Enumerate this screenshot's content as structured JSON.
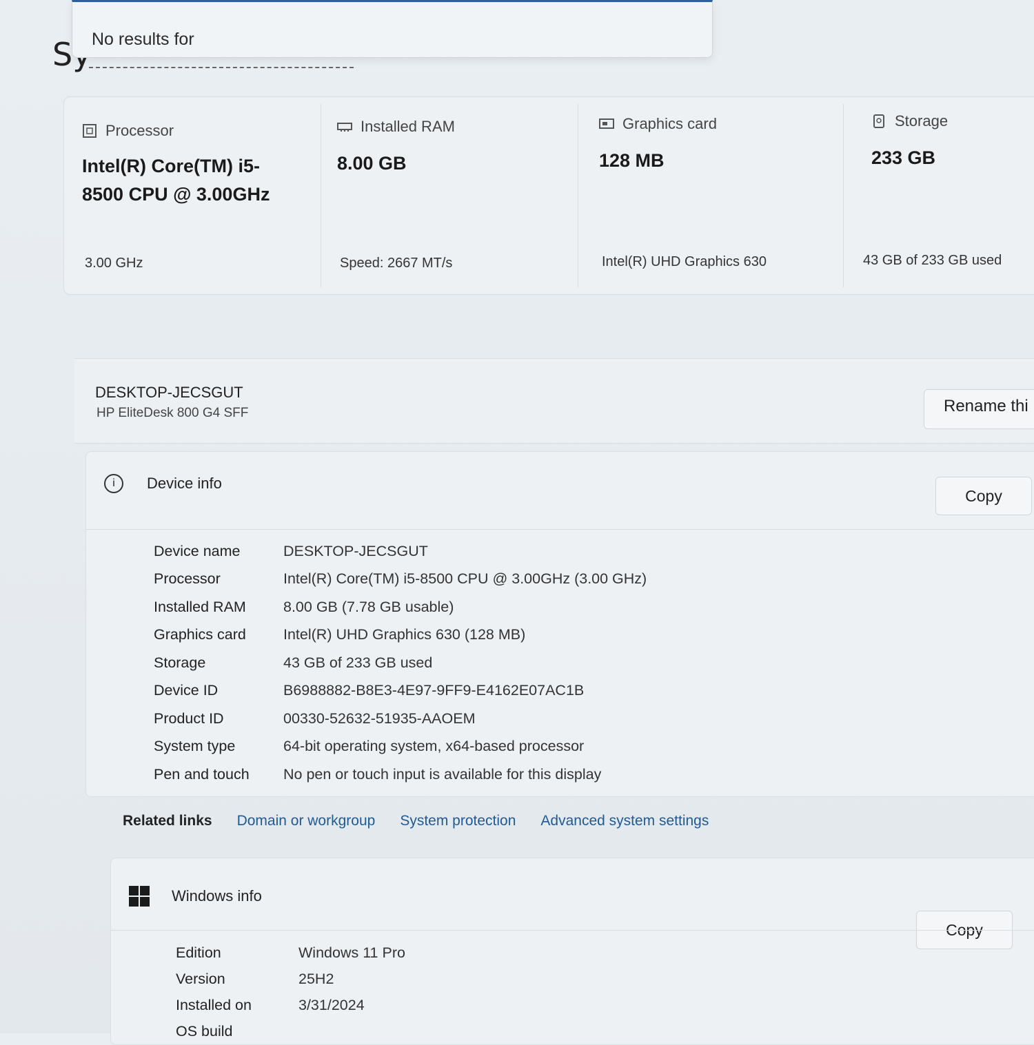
{
  "page": {
    "title_fragment": "Sy"
  },
  "search": {
    "no_results_text": "No results for"
  },
  "specs": [
    {
      "icon": "processor-icon",
      "label": "Processor",
      "value": "Intel(R) Core(TM) i5-8500 CPU @ 3.00GHz",
      "sub": "3.00 GHz"
    },
    {
      "icon": "ram-icon",
      "label": "Installed RAM",
      "value": "8.00 GB",
      "sub": "Speed: 2667 MT/s"
    },
    {
      "icon": "graphics-card-icon",
      "label": "Graphics card",
      "value": "128 MB",
      "sub": "Intel(R) UHD Graphics 630"
    },
    {
      "icon": "storage-icon",
      "label": "Storage",
      "value": "233 GB",
      "sub": "43 GB of 233 GB used"
    }
  ],
  "device": {
    "name": "DESKTOP-JECSGUT",
    "model": "HP EliteDesk 800 G4 SFF",
    "rename_label": "Rename thi"
  },
  "device_info": {
    "title": "Device info",
    "copy_label": "Copy",
    "rows": [
      {
        "k": "Device name",
        "v": "DESKTOP-JECSGUT"
      },
      {
        "k": "Processor",
        "v": "Intel(R) Core(TM) i5-8500 CPU @ 3.00GHz (3.00 GHz)"
      },
      {
        "k": "Installed RAM",
        "v": "8.00 GB (7.78 GB usable)"
      },
      {
        "k": "Graphics card",
        "v": "Intel(R) UHD Graphics 630 (128 MB)"
      },
      {
        "k": "Storage",
        "v": "43 GB of 233 GB used"
      },
      {
        "k": "Device ID",
        "v": "B6988882-B8E3-4E97-9FF9-E4162E07AC1B"
      },
      {
        "k": "Product ID",
        "v": "00330-52632-51935-AAOEM"
      },
      {
        "k": "System type",
        "v": "64-bit operating system, x64-based processor"
      },
      {
        "k": "Pen and touch",
        "v": "No pen or touch input is available for this display"
      }
    ]
  },
  "related_links": {
    "label": "Related links",
    "links": [
      "Domain or workgroup",
      "System protection",
      "Advanced system settings"
    ]
  },
  "windows_info": {
    "title": "Windows info",
    "copy_label": "Copy",
    "rows": [
      {
        "k": "Edition",
        "v": "Windows 11 Pro"
      },
      {
        "k": "Version",
        "v": "25H2"
      },
      {
        "k": "Installed on",
        "v": "3/31/2024"
      },
      {
        "k": "OS build",
        "v": ""
      }
    ]
  }
}
